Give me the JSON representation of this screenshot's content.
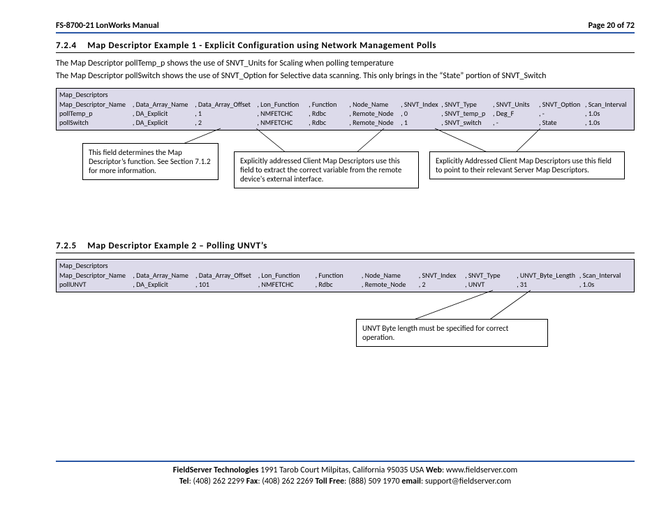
{
  "header": {
    "doc_title": "FS-8700-21 LonWorks Manual",
    "page_label": "Page 20 of 72"
  },
  "section1": {
    "number": "7.2.4",
    "title": "Map Descriptor Example 1 - Explicit Configuration using Network Management Polls",
    "p1": "The Map Descriptor pollTemp_p shows the use of SNVT_Units for Scaling when polling temperature",
    "p2": "The Map Descriptor pollSwitch shows the use of SNVT_Option for Selective data scanning. This only brings in the “State” portion of SNVT_Switch",
    "table_heading": "Map_Descriptors",
    "columns": [
      "Map_Descriptor_Name",
      ", Data_Array_Name",
      ", Data_Array_Offset",
      ", Lon_Function",
      ", Function",
      ", Node_Name",
      ", SNVT_Index",
      ", SNVT_Type",
      ", SNVT_Units",
      ", SNVT_Option",
      ", Scan_Interval"
    ],
    "rows": [
      [
        "pollTemp_p",
        ", DA_Explicit",
        ", 1",
        ", NMFETCHC",
        ", Rdbc",
        ", Remote_Node",
        ", 0",
        ", SNVT_temp_p",
        ", Deg_F",
        ", -",
        ", 1.0s"
      ],
      [
        "pollSwitch",
        ", DA_Explicit",
        ", 2",
        ", NMFETCHC",
        ", Rdbc",
        ", Remote_Node",
        ", 1",
        ", SNVT_switch",
        ", -",
        ", State",
        ", 1.0s"
      ]
    ],
    "callout1": "This field determines the Map Descriptor’s function. See Section 7.1.2 for more information.",
    "callout2": "Explicitly addressed Client Map Descriptors use this field to extract the correct variable from the remote device's external interface.",
    "callout3": "Explicitly Addressed Client Map Descriptors use this field to point to their relevant Server Map Descriptors."
  },
  "section2": {
    "number": "7.2.5",
    "title": "Map Descriptor Example 2 – Polling UNVT’s",
    "table_heading": "Map_Descriptors",
    "columns": [
      "Map_Descriptor_Name",
      ", Data_Array_Name",
      ", Data_Array_Offset",
      ", Lon_Function",
      ", Function",
      ", Node_Name",
      ", SNVT_Index",
      ", SNVT_Type",
      ", UNVT_Byte_Length",
      ", Scan_Interval"
    ],
    "rows": [
      [
        "pollUNVT",
        ", DA_Explicit",
        ", 101",
        ", NMFETCHC",
        ", Rdbc",
        ", Remote_Node",
        ", 2",
        ", UNVT",
        ", 31",
        ", 1.0s"
      ]
    ],
    "callout1": "UNVT Byte length must be specified for correct operation."
  },
  "footer": {
    "line1_bold": "FieldServer Technologies",
    "line1_addr": " 1991 Tarob Court Milpitas, California 95035 USA   ",
    "web_label": "Web",
    "web_val": ": www.fieldserver.com",
    "tel_label": "Tel",
    "tel_val": ": (408) 262 2299  ",
    "fax_label": "Fax",
    "fax_val": ": (408) 262 2269  ",
    "tollfree_label": "Toll Free",
    "tollfree_val": ": (888) 509 1970  ",
    "email_label": "email",
    "email_val": ": support@fieldserver.com"
  }
}
